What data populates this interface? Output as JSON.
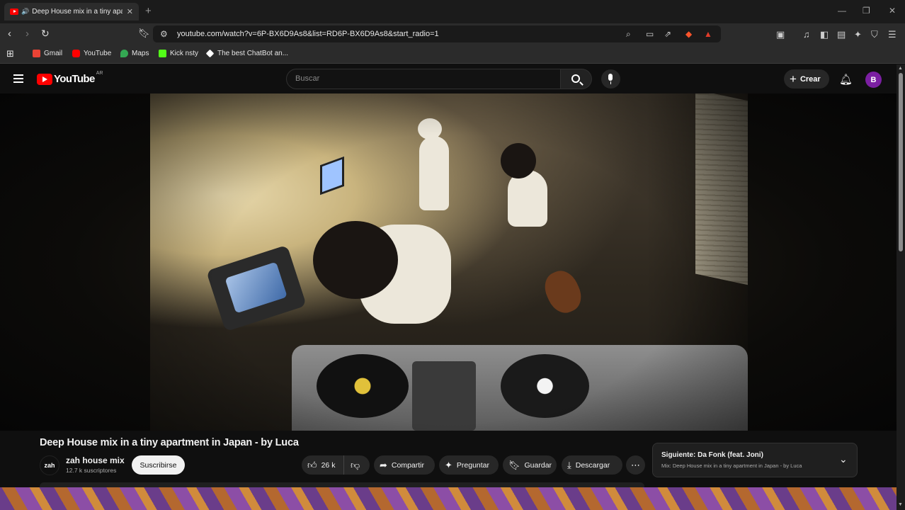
{
  "browser": {
    "tab_title": "Deep House mix in a tiny apartment in Japan - by Luca",
    "tab_close": "✕",
    "new_tab": "+",
    "url": "youtube.com/watch?v=6P-BX6D9As8&list=RD6P-BX6D9As8&start_radio=1",
    "bookmarks": [
      {
        "label": "Gmail",
        "color": "#ea4335"
      },
      {
        "label": "YouTube",
        "color": "#ff0000"
      },
      {
        "label": "Maps",
        "color": "#34a853"
      },
      {
        "label": "Kick nsty",
        "color": "#53fc18"
      },
      {
        "label": "The best ChatBot an...",
        "color": "#ffffff"
      }
    ]
  },
  "youtube": {
    "logo_text": "YouTube",
    "country_code": "AR",
    "search_placeholder": "Buscar",
    "create_label": "Crear",
    "avatar_letter": "B",
    "avatar_color": "#7b1fa2"
  },
  "video": {
    "title": "Deep House mix in a tiny apartment in Japan - by Luca",
    "channel_avatar_text": "zah",
    "channel_name": "zah house mix",
    "subscribers": "12.7 k suscriptores",
    "subscribe_label": "Suscribirse",
    "likes": "26 k",
    "share_label": "Compartir",
    "ask_label": "Preguntar",
    "save_label": "Guardar",
    "download_label": "Descargar"
  },
  "next_up": {
    "title": "Siguiente: Da Fonk (feat. Joni)",
    "subtitle": "Mix: Deep House mix in a tiny apartment in Japan - by Luca"
  }
}
